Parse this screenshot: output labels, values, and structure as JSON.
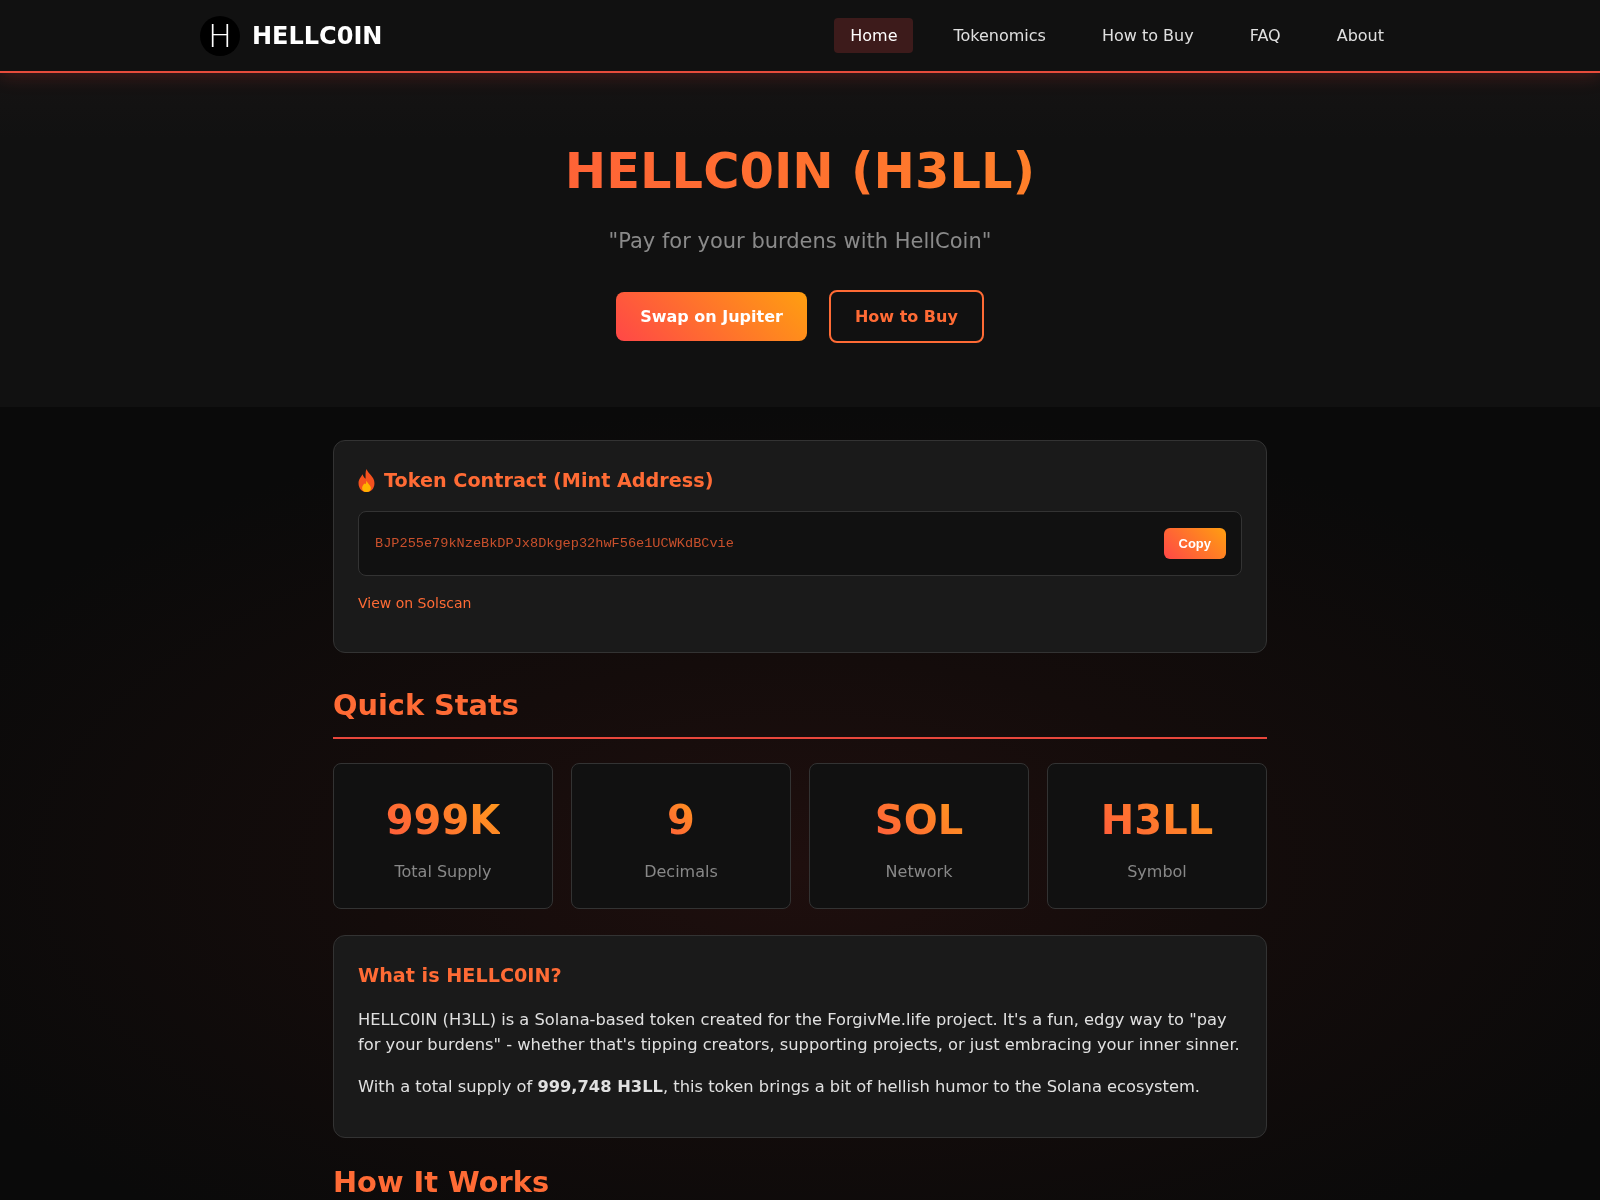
{
  "header": {
    "logo_mark": "H",
    "brand": "HELLC0IN",
    "nav": [
      {
        "label": "Home",
        "selected": true
      },
      {
        "label": "Tokenomics",
        "selected": false
      },
      {
        "label": "How to Buy",
        "selected": false
      },
      {
        "label": "FAQ",
        "selected": false
      },
      {
        "label": "About",
        "selected": false
      }
    ]
  },
  "hero": {
    "title": "HELLC0IN (H3LL)",
    "tagline": "\"Pay for your burdens with HellCoin\"",
    "buttons": [
      {
        "label": "Swap on Jupiter",
        "kind": "primary"
      },
      {
        "label": "How to Buy",
        "kind": "outline"
      }
    ]
  },
  "contract_card": {
    "title": "Token Contract (Mint Address)",
    "address": "BJP255e79kNzeBkDPJx8Dkgep32hwF56e1UCWKdBCvie",
    "copy_button": "Copy",
    "link": "View on Solscan"
  },
  "quick_stats": {
    "heading": "Quick Stats",
    "stats": [
      {
        "value": "999K",
        "label": "Total Supply"
      },
      {
        "value": "9",
        "label": "Decimals"
      },
      {
        "value": "SOL",
        "label": "Network"
      },
      {
        "value": "H3LL",
        "label": "Symbol"
      }
    ]
  },
  "about_card": {
    "title": "What is HELLC0IN?",
    "paragraphs": [
      "HELLC0IN (H3LL) is a Solana-based token created for the ForgivMe.life project. It's a fun, edgy way to \"pay for your burdens\" - whether that's tipping creators, supporting projects, or just embracing your inner sinner.",
      "With a total supply of **999,748 H3LL**, this token brings a bit of hellish humor to the Solana ecosystem."
    ]
  },
  "next_section": {
    "heading": "How It Works"
  }
}
